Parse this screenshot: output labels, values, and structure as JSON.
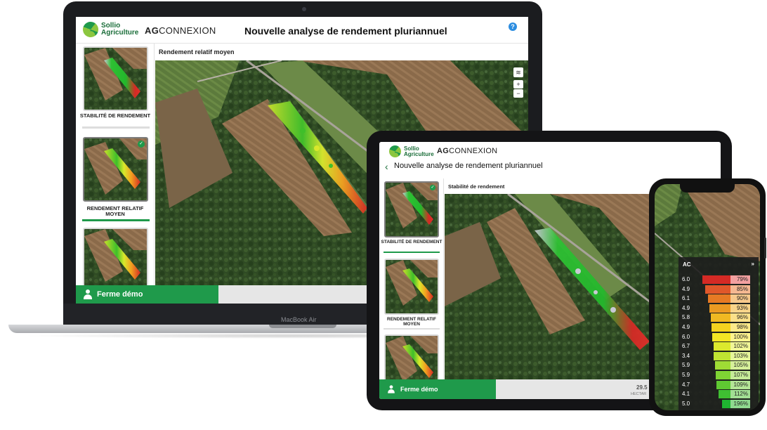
{
  "brand": {
    "sollio_line1": "Sollio",
    "sollio_line2": "Agriculture",
    "ag": "AG",
    "connexion": "CONNEXION"
  },
  "laptop": {
    "title": "Nouvelle analyse de rendement pluriannuel",
    "help": "?",
    "panel_title": "Rendement relatif moyen",
    "thumbs": [
      {
        "label": "STABILITÉ DE RENDEMENT"
      },
      {
        "label": "RENDEMENT RELATIF MOYEN"
      }
    ],
    "footer_farm": "Ferme démo",
    "device_label": "MacBook Air",
    "map_controls": {
      "zoom_in": "+",
      "zoom_out": "−"
    }
  },
  "tablet": {
    "title": "Nouvelle analyse de rendement pluriannuel",
    "back": "‹",
    "panel_title": "Stabilité de rendement",
    "thumbs": [
      {
        "label": "STABILITÉ DE RENDEMENT"
      },
      {
        "label": "RENDEMENT RELATIF MOYEN"
      }
    ],
    "footer_farm": "Ferme démo",
    "area_value": "29.5",
    "area_unit": "HECTAR"
  },
  "phone": {
    "legend_header": "AC",
    "legend_toggle": "»",
    "rows": [
      {
        "ac": "6.0",
        "pct": "79%",
        "value": 0.79,
        "color": "#d42a25",
        "pct_bg": "#f2a0a0"
      },
      {
        "ac": "4.9",
        "pct": "85%",
        "value": 0.85,
        "color": "#e0572a",
        "pct_bg": "#f5b891"
      },
      {
        "ac": "6.1",
        "pct": "90%",
        "value": 0.9,
        "color": "#e67a24",
        "pct_bg": "#f7c98c"
      },
      {
        "ac": "4.9",
        "pct": "93%",
        "value": 0.93,
        "color": "#eb9a22",
        "pct_bg": "#f9d58a"
      },
      {
        "ac": "5.8",
        "pct": "96%",
        "value": 0.96,
        "color": "#f0b922",
        "pct_bg": "#fbe18a"
      },
      {
        "ac": "4.9",
        "pct": "98%",
        "value": 0.98,
        "color": "#f3d21f",
        "pct_bg": "#fcea8a"
      },
      {
        "ac": "6.0",
        "pct": "100%",
        "value": 1.0,
        "color": "#f2e524",
        "pct_bg": "#fdf38e"
      },
      {
        "ac": "6.7",
        "pct": "102%",
        "value": 1.02,
        "color": "#dce92d",
        "pct_bg": "#f1f697"
      },
      {
        "ac": "3.4",
        "pct": "103%",
        "value": 1.03,
        "color": "#bfe432",
        "pct_bg": "#e5f59a"
      },
      {
        "ac": "5.9",
        "pct": "105%",
        "value": 1.05,
        "color": "#9fdc35",
        "pct_bg": "#d6f09a"
      },
      {
        "ac": "5.9",
        "pct": "107%",
        "value": 1.07,
        "color": "#7fd334",
        "pct_bg": "#c5eb98"
      },
      {
        "ac": "4.7",
        "pct": "109%",
        "value": 1.09,
        "color": "#5fc932",
        "pct_bg": "#b4e596"
      },
      {
        "ac": "4.1",
        "pct": "112%",
        "value": 1.12,
        "color": "#3fbf32",
        "pct_bg": "#a2df94"
      },
      {
        "ac": "5.0",
        "pct": "196%",
        "value": 1.96,
        "color": "#1fb531",
        "pct_bg": "#8fd98f"
      }
    ]
  }
}
